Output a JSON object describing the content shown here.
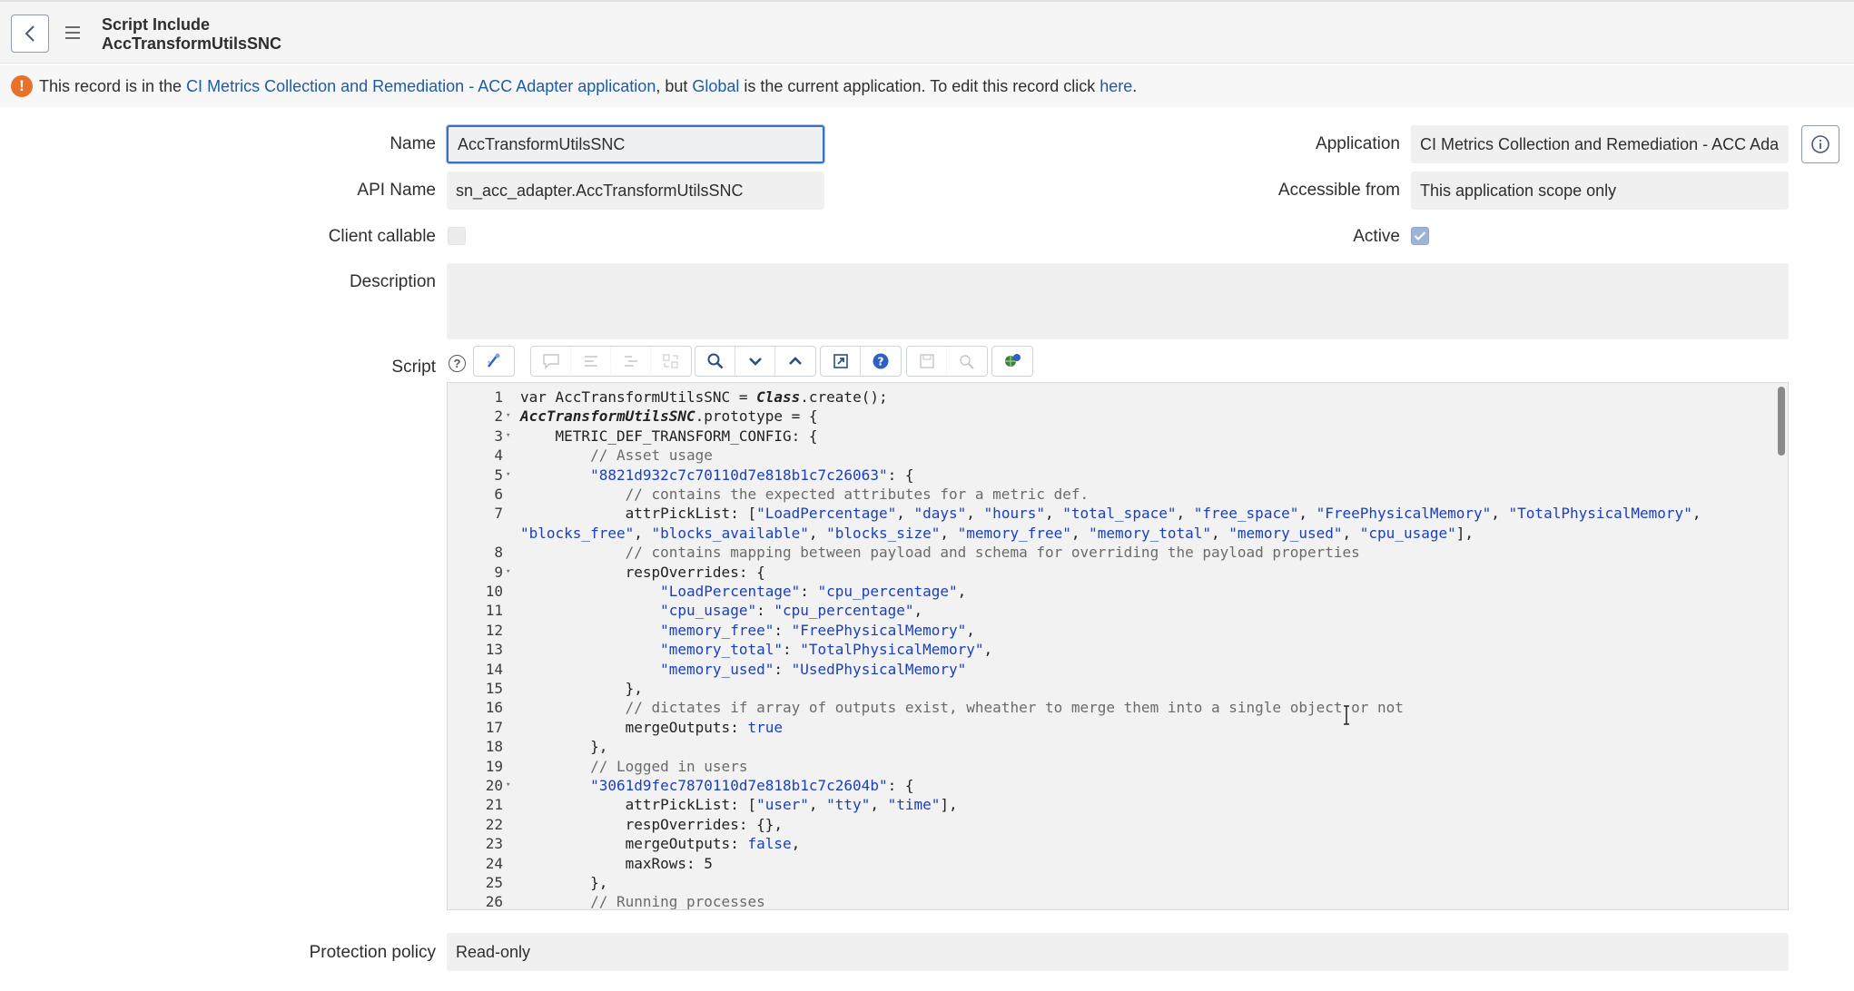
{
  "header": {
    "title_line1": "Script Include",
    "title_line2": "AccTransformUtilsSNC"
  },
  "notice": {
    "prefix": "This record is in the ",
    "app_link": "CI Metrics Collection and Remediation - ACC Adapter",
    "app_word": " application",
    "middle": ", but ",
    "global_link": "Global",
    "suffix": " is the current application. To edit this record click ",
    "here_link": "here",
    "end": "."
  },
  "form": {
    "name_label": "Name",
    "name_value": "AccTransformUtilsSNC",
    "api_label": "API Name",
    "api_value": "sn_acc_adapter.AccTransformUtilsSNC",
    "client_callable_label": "Client callable",
    "client_callable_checked": false,
    "description_label": "Description",
    "description_value": "",
    "application_label": "Application",
    "application_value": "CI Metrics Collection and Remediation - ACC Ada",
    "accessible_label": "Accessible from",
    "accessible_value": "This application scope only",
    "active_label": "Active",
    "active_checked": true,
    "script_label": "Script",
    "protection_label": "Protection policy",
    "protection_value": "Read-only"
  },
  "toolbar": {
    "buttons": [
      {
        "name": "format-icon",
        "disabled": false
      },
      {
        "name": "comment-icon",
        "disabled": true
      },
      {
        "name": "uncomment-icon",
        "disabled": true
      },
      {
        "name": "indent-icon",
        "disabled": true
      },
      {
        "name": "replace-all-icon",
        "disabled": true
      },
      {
        "name": "search-icon",
        "disabled": false
      },
      {
        "name": "chevron-down-icon",
        "disabled": false
      },
      {
        "name": "chevron-up-icon",
        "disabled": false
      },
      {
        "name": "fullscreen-icon",
        "disabled": false
      },
      {
        "name": "help-circle-icon",
        "disabled": false
      },
      {
        "name": "save-icon",
        "disabled": true
      },
      {
        "name": "toggle-syntax-icon",
        "disabled": true
      },
      {
        "name": "debug-icon",
        "disabled": false
      }
    ]
  },
  "code_lines": [
    {
      "n": "1",
      "fold": false,
      "text": "var AccTransformUtilsSNC = Class.create();"
    },
    {
      "n": "2",
      "fold": true,
      "text": "AccTransformUtilsSNC.prototype = {"
    },
    {
      "n": "3",
      "fold": true,
      "text": "    METRIC_DEF_TRANSFORM_CONFIG: {"
    },
    {
      "n": "4",
      "fold": false,
      "text": "        // Asset usage"
    },
    {
      "n": "5",
      "fold": true,
      "text": "        \"8821d932c7c70110d7e818b1c7c26063\": {"
    },
    {
      "n": "6",
      "fold": false,
      "text": "            // contains the expected attributes for a metric def."
    },
    {
      "n": "7",
      "fold": false,
      "text": "            attrPickList: [\"LoadPercentage\", \"days\", \"hours\", \"total_space\", \"free_space\", \"FreePhysicalMemory\", \"TotalPhysicalMemory\","
    },
    {
      "n": "",
      "fold": false,
      "text": "\"blocks_free\", \"blocks_available\", \"blocks_size\", \"memory_free\", \"memory_total\", \"memory_used\", \"cpu_usage\"],"
    },
    {
      "n": "8",
      "fold": false,
      "text": "            // contains mapping between payload and schema for overriding the payload properties"
    },
    {
      "n": "9",
      "fold": true,
      "text": "            respOverrides: {"
    },
    {
      "n": "10",
      "fold": false,
      "text": "                \"LoadPercentage\": \"cpu_percentage\","
    },
    {
      "n": "11",
      "fold": false,
      "text": "                \"cpu_usage\": \"cpu_percentage\","
    },
    {
      "n": "12",
      "fold": false,
      "text": "                \"memory_free\": \"FreePhysicalMemory\","
    },
    {
      "n": "13",
      "fold": false,
      "text": "                \"memory_total\": \"TotalPhysicalMemory\","
    },
    {
      "n": "14",
      "fold": false,
      "text": "                \"memory_used\": \"UsedPhysicalMemory\""
    },
    {
      "n": "15",
      "fold": false,
      "text": "            },"
    },
    {
      "n": "16",
      "fold": false,
      "text": "            // dictates if array of outputs exist, wheather to merge them into a single object or not"
    },
    {
      "n": "17",
      "fold": false,
      "text": "            mergeOutputs: true"
    },
    {
      "n": "18",
      "fold": false,
      "text": "        },"
    },
    {
      "n": "19",
      "fold": false,
      "text": "        // Logged in users"
    },
    {
      "n": "20",
      "fold": true,
      "text": "        \"3061d9fec7870110d7e818b1c7c2604b\": {"
    },
    {
      "n": "21",
      "fold": false,
      "text": "            attrPickList: [\"user\", \"tty\", \"time\"],"
    },
    {
      "n": "22",
      "fold": false,
      "text": "            respOverrides: {},"
    },
    {
      "n": "23",
      "fold": false,
      "text": "            mergeOutputs: false,"
    },
    {
      "n": "24",
      "fold": false,
      "text": "            maxRows: 5"
    },
    {
      "n": "25",
      "fold": false,
      "text": "        },"
    },
    {
      "n": "26",
      "fold": false,
      "text": "        // Running processes"
    }
  ]
}
